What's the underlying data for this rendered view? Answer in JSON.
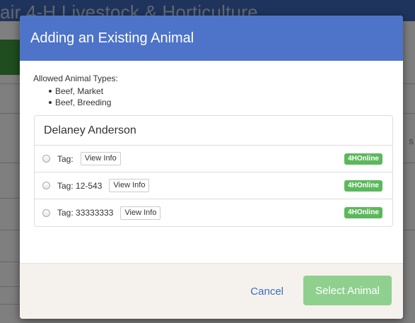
{
  "background": {
    "page_title": "air 4-H Livestock & Horticulture",
    "right_text": "s"
  },
  "modal": {
    "title": "Adding an Existing Animal",
    "allowed_label": "Allowed Animal Types:",
    "allowed_types": [
      "Beef, Market",
      "Beef, Breeding"
    ],
    "exhibitor": "Delaney Anderson",
    "animals": [
      {
        "tag": "Tag:",
        "view_label": "View Info",
        "badge": "4HOnline"
      },
      {
        "tag": "Tag: 12-543",
        "view_label": "View Info",
        "badge": "4HOnline"
      },
      {
        "tag": "Tag: 33333333",
        "view_label": "View Info",
        "badge": "4HOnline"
      }
    ],
    "footer": {
      "cancel_label": "Cancel",
      "select_label": "Select Animal"
    }
  },
  "colors": {
    "header_blue": "#4d74c9",
    "badge_green": "#5cb85c",
    "select_button_disabled": "#90d08f",
    "link_blue": "#3d6fbd"
  }
}
